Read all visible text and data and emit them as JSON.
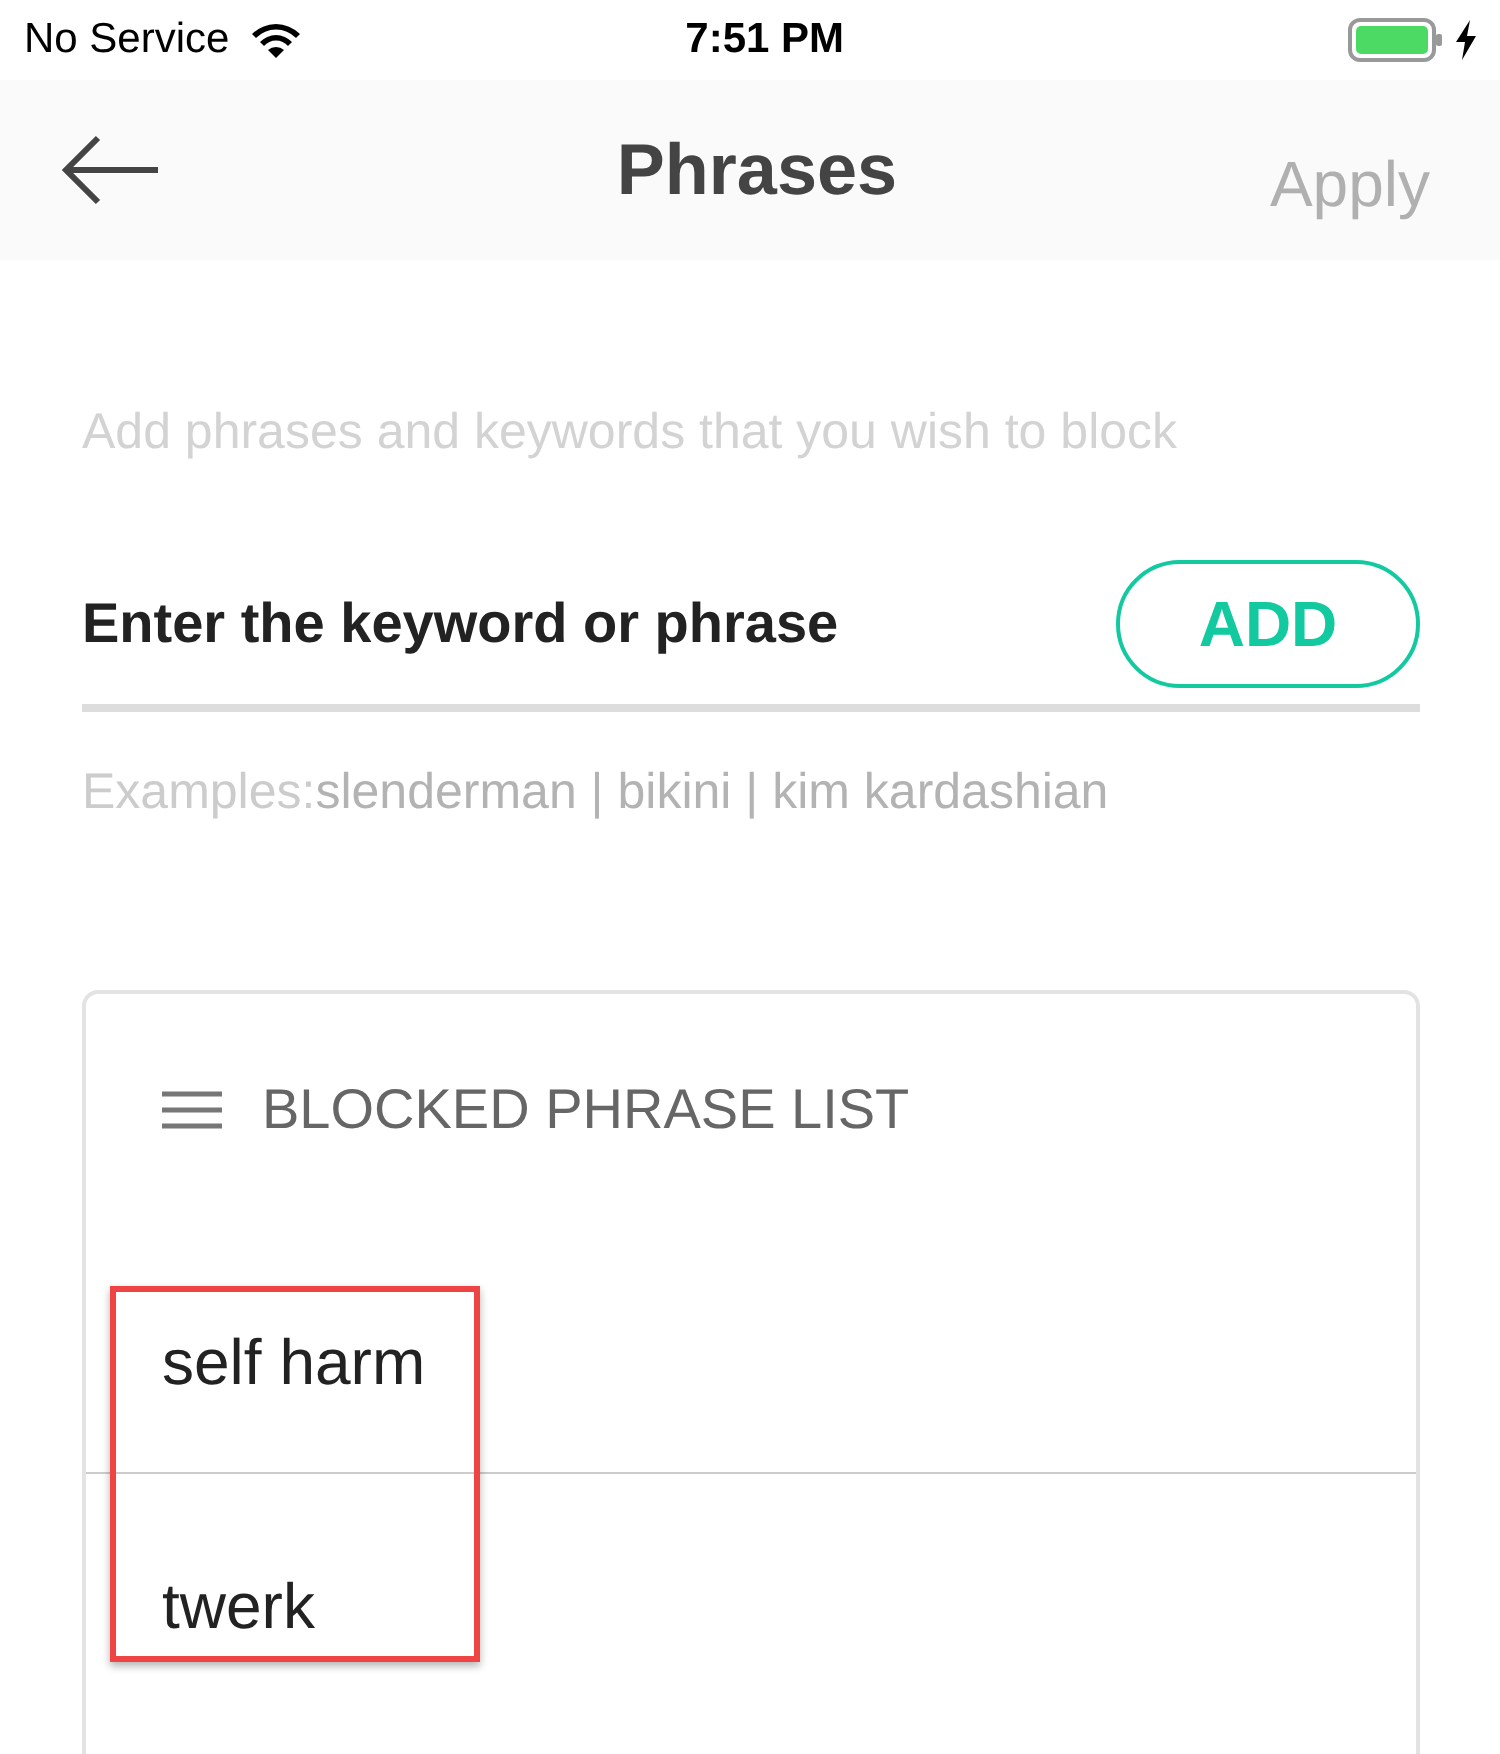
{
  "status_bar": {
    "carrier": "No Service",
    "time": "7:51 PM"
  },
  "nav": {
    "title": "Phrases",
    "apply": {
      "label": "Apply",
      "disabled": true
    }
  },
  "hint": "Add phrases and keywords that you wish to block",
  "keyword_field": {
    "placeholder": "Enter the keyword or phrase"
  },
  "add_button": "ADD",
  "examples_label": "Examples:",
  "examples": "slenderman | bikini | kim kardashian",
  "blocked_list": {
    "title": "BLOCKED PHRASE LIST",
    "items": [
      {
        "text": "self harm"
      },
      {
        "text": "twerk"
      }
    ],
    "highlight_frame": true
  }
}
